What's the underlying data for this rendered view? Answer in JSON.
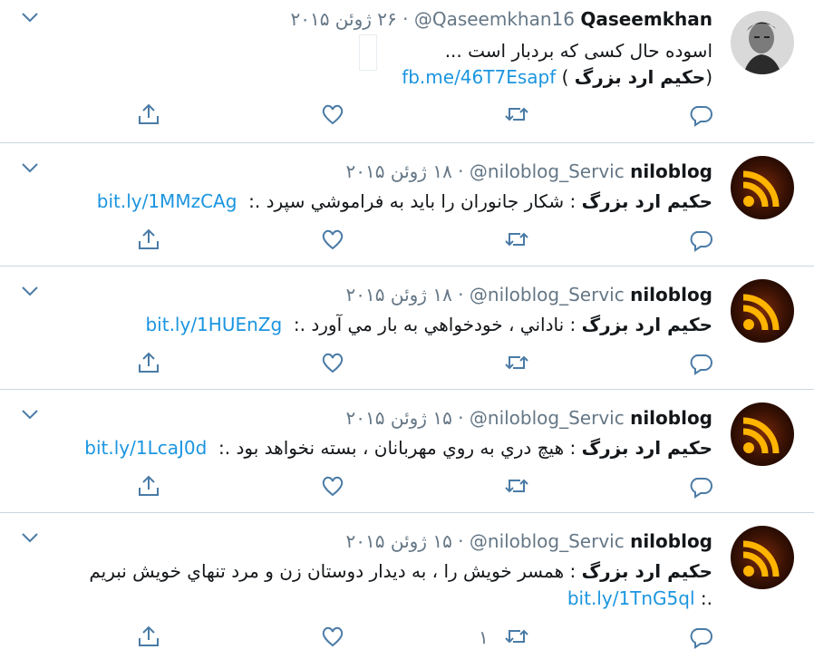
{
  "tweets": [
    {
      "name": "Qaseemkhan",
      "handle": "@Qaseemkhan16",
      "date": "۲۶ ژوئن ۲۰۱۵",
      "text_line1": "اسوده حال کسی که بردبار است ...",
      "link": "fb.me/46T7Esapf",
      "bold_label": "حکیم ارد بزرگ",
      "retweet_count": ""
    },
    {
      "name": "niloblog",
      "handle": "@niloblog_Servic",
      "date": "۱۸ ژوئن ۲۰۱۵",
      "bold_label": "حکیم ارد بزرگ",
      "colon": " : ",
      "text": "شکار جانوران را باید به فراموشي سپرد .: ",
      "link": "bit.ly/1MMzCAg",
      "retweet_count": ""
    },
    {
      "name": "niloblog",
      "handle": "@niloblog_Servic",
      "date": "۱۸ ژوئن ۲۰۱۵",
      "bold_label": "حکیم ارد بزرگ",
      "colon": " : ",
      "text": "ناداني ، خودخواهي به بار مي آورد .: ",
      "link": "bit.ly/1HUEnZg",
      "retweet_count": ""
    },
    {
      "name": "niloblog",
      "handle": "@niloblog_Servic",
      "date": "۱۵ ژوئن ۲۰۱۵",
      "bold_label": "حکیم ارد بزرگ",
      "colon": " : ",
      "text": "هيچ دري به روي مهربانان ، بسته نخواهد بود .: ",
      "link": "bit.ly/1LcaJ0d",
      "retweet_count": ""
    },
    {
      "name": "niloblog",
      "handle": "@niloblog_Servic",
      "date": "۱۵ ژوئن ۲۰۱۵",
      "bold_label": "حکیم ارد بزرگ",
      "colon": " : ",
      "text": "همسر خويش را ، به ديدار دوستان زن و مرد تنهاي خويش نبريم",
      "text_line2": ".: ",
      "link": "bit.ly/1TnG5ql",
      "retweet_count": "۱"
    }
  ],
  "icons": {
    "chevron": "chevron-down-icon",
    "share": "share-icon",
    "like": "heart-icon",
    "retweet": "retweet-icon",
    "reply": "reply-icon"
  },
  "colors": {
    "link": "#1b95e0",
    "muted": "#657786",
    "icon": "#4a7ba6",
    "divider": "#c9d6e0"
  }
}
